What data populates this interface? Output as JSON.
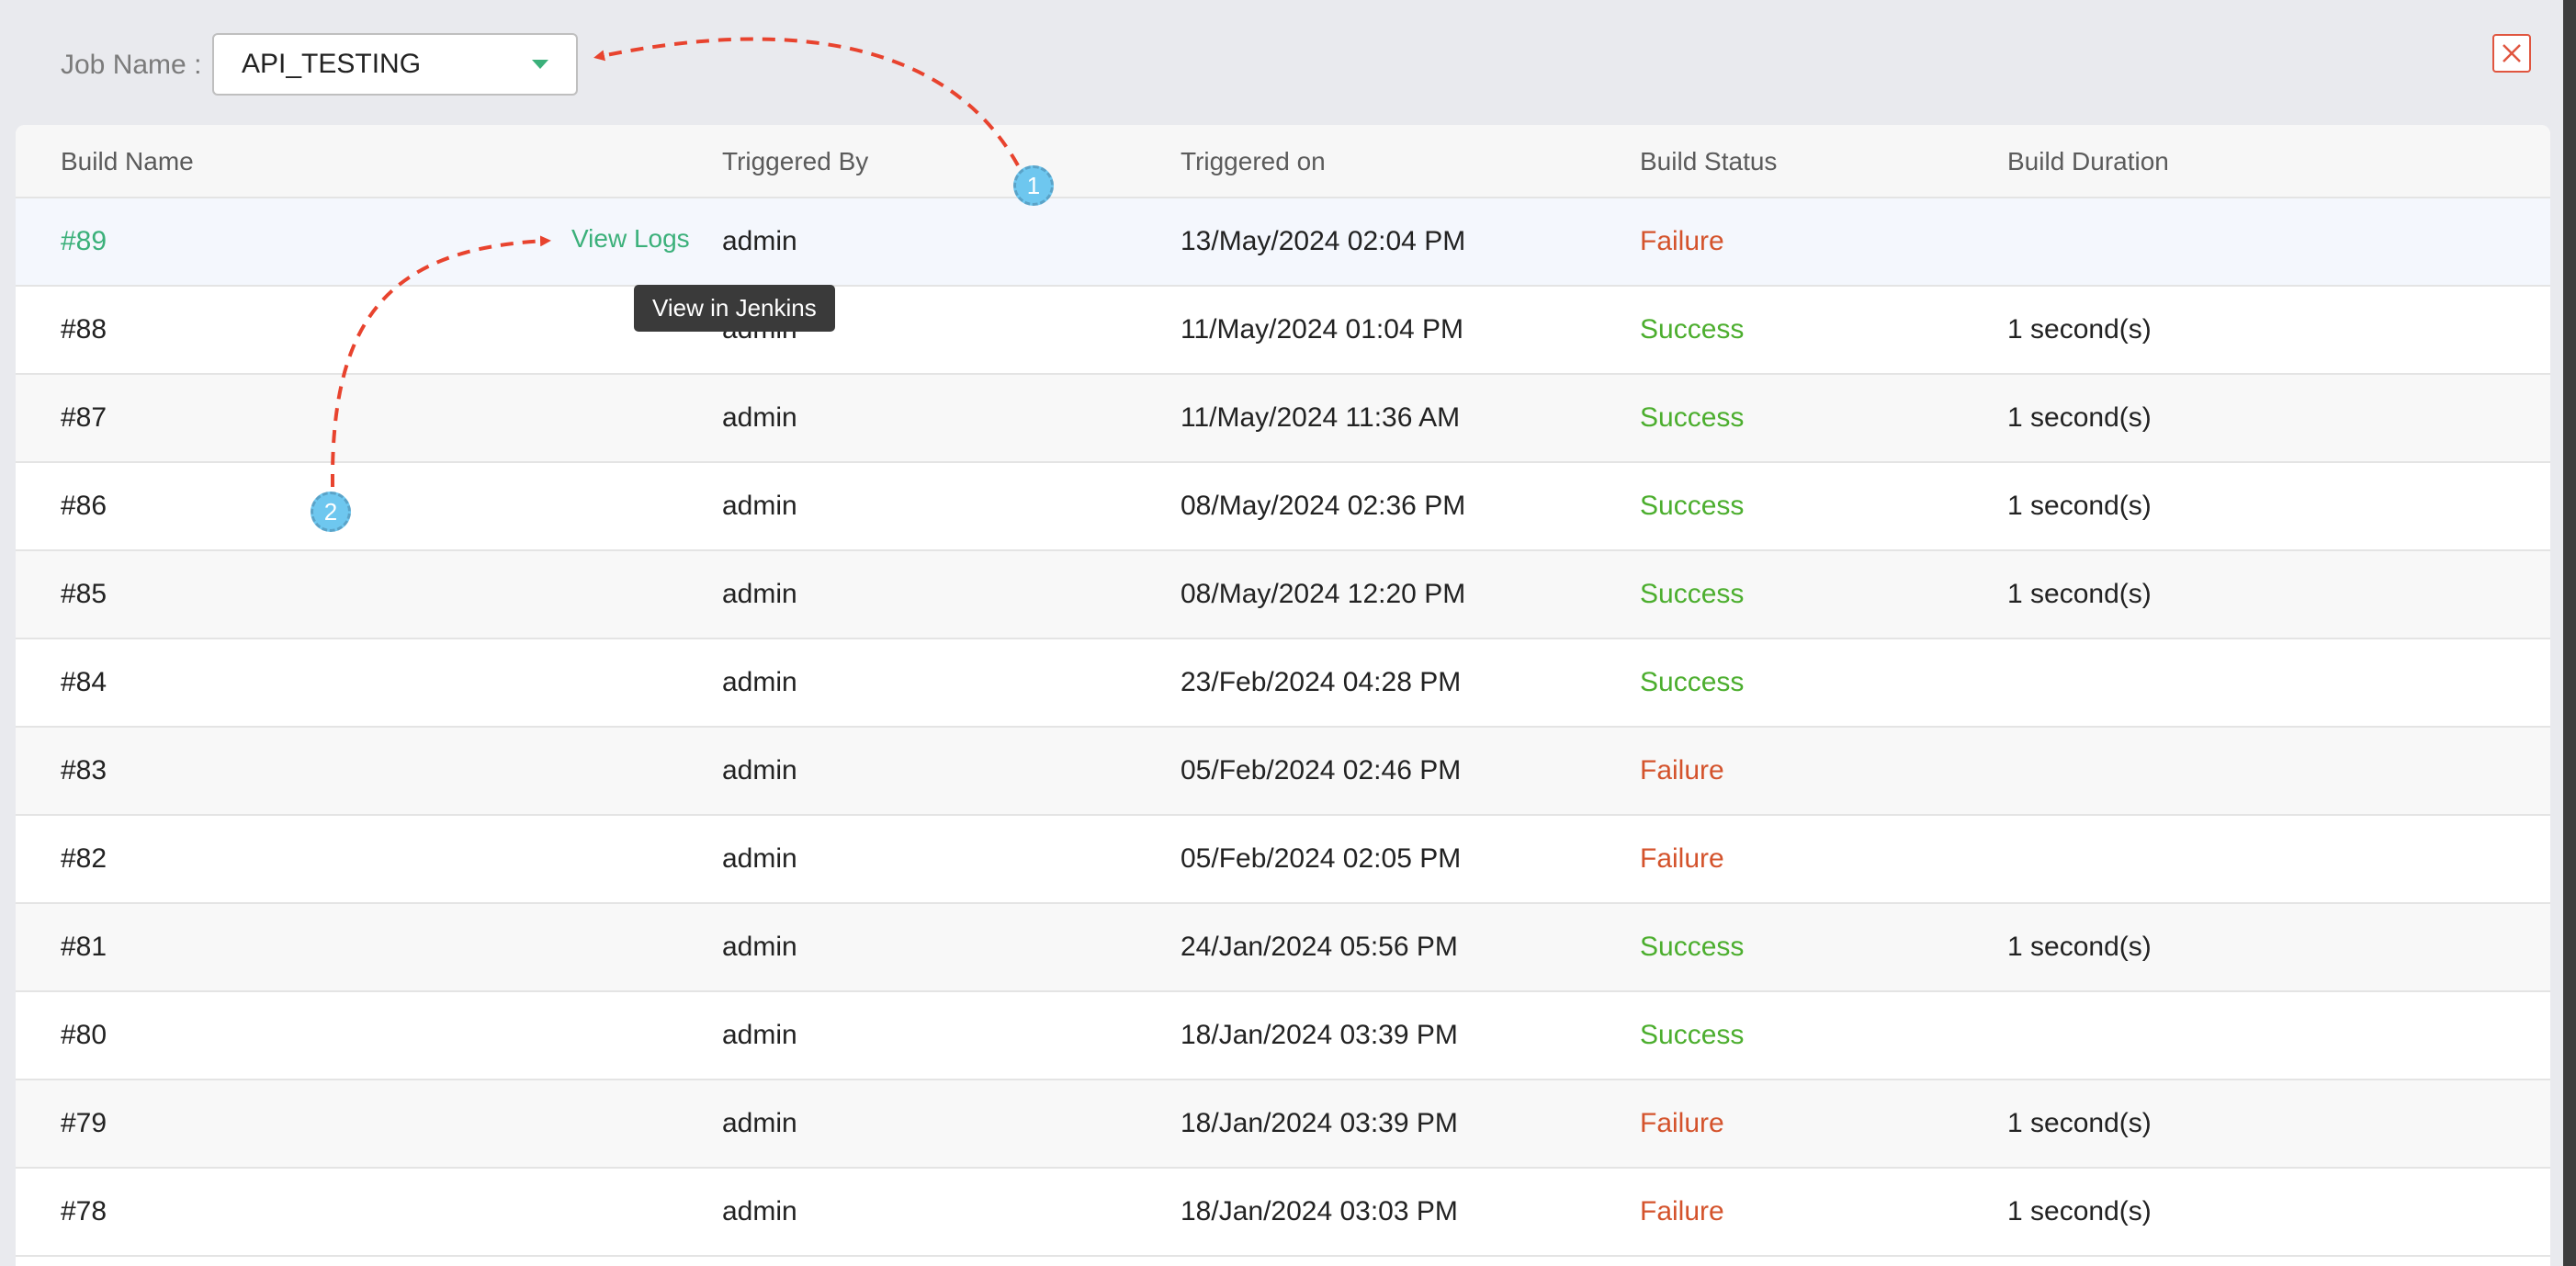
{
  "header": {
    "job_label": "Job Name :",
    "job_selected": "API_TESTING"
  },
  "columns": [
    "Build Name",
    "Triggered By",
    "Triggered on",
    "Build Status",
    "Build Duration"
  ],
  "row_actions": {
    "view_logs": "View Logs",
    "tooltip": "View in Jenkins"
  },
  "rows": [
    {
      "build": "#89",
      "by": "admin",
      "on": "13/May/2024 02:04 PM",
      "status": "Failure",
      "duration": ""
    },
    {
      "build": "#88",
      "by": "admin",
      "on": "11/May/2024 01:04 PM",
      "status": "Success",
      "duration": "1 second(s)"
    },
    {
      "build": "#87",
      "by": "admin",
      "on": "11/May/2024 11:36 AM",
      "status": "Success",
      "duration": "1 second(s)"
    },
    {
      "build": "#86",
      "by": "admin",
      "on": "08/May/2024 02:36 PM",
      "status": "Success",
      "duration": "1 second(s)"
    },
    {
      "build": "#85",
      "by": "admin",
      "on": "08/May/2024 12:20 PM",
      "status": "Success",
      "duration": "1 second(s)"
    },
    {
      "build": "#84",
      "by": "admin",
      "on": "23/Feb/2024 04:28 PM",
      "status": "Success",
      "duration": ""
    },
    {
      "build": "#83",
      "by": "admin",
      "on": "05/Feb/2024 02:46 PM",
      "status": "Failure",
      "duration": ""
    },
    {
      "build": "#82",
      "by": "admin",
      "on": "05/Feb/2024 02:05 PM",
      "status": "Failure",
      "duration": ""
    },
    {
      "build": "#81",
      "by": "admin",
      "on": "24/Jan/2024 05:56 PM",
      "status": "Success",
      "duration": "1 second(s)"
    },
    {
      "build": "#80",
      "by": "admin",
      "on": "18/Jan/2024 03:39 PM",
      "status": "Success",
      "duration": ""
    },
    {
      "build": "#79",
      "by": "admin",
      "on": "18/Jan/2024 03:39 PM",
      "status": "Failure",
      "duration": "1 second(s)"
    },
    {
      "build": "#78",
      "by": "admin",
      "on": "18/Jan/2024 03:03 PM",
      "status": "Failure",
      "duration": "1 second(s)"
    }
  ],
  "annotations": {
    "badge_1": "1",
    "badge_2": "2"
  },
  "colors": {
    "accent": "#3bb07a",
    "success": "#4cae2e",
    "failure": "#d4532c",
    "annotation_arrow": "#e8432e",
    "badge": "#6ec7ef"
  },
  "icons": {
    "dropdown": "chevron-down-icon",
    "close": "close-icon"
  }
}
